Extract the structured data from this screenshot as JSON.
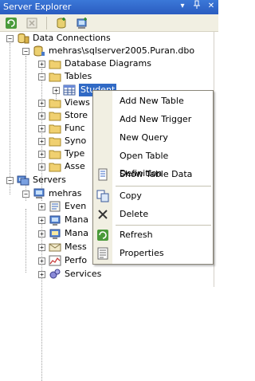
{
  "window": {
    "title": "Server Explorer",
    "controls": [
      "▾",
      "📌",
      "✕"
    ]
  },
  "toolbar": {
    "buttons": [
      "refresh-icon",
      "stop-icon",
      "connect-to-database-icon",
      "connect-to-server-icon"
    ]
  },
  "tree": {
    "data_connections": "Data Connections",
    "connection": "mehras\\sqlserver2005.Puran.dbo",
    "database_diagrams": "Database Diagrams",
    "tables": "Tables",
    "student": "Student",
    "views": "Views",
    "stored": "Store",
    "functions": "Func",
    "synonyms": "Syno",
    "types": "Type",
    "assemblies": "Asse",
    "servers": "Servers",
    "server": "mehras",
    "event_logs": "Even",
    "management_classes": "Mana",
    "management_events": "Mana",
    "message_queues": "Mess",
    "performance_counters": "Perfo",
    "services": "Services"
  },
  "context_menu": {
    "items": [
      {
        "label": "Add New Table"
      },
      {
        "label": "Add New Trigger"
      },
      {
        "label": "New Query"
      },
      {
        "label": "Open Table Definition"
      },
      {
        "label": "Show Table Data"
      },
      {
        "label": "Copy"
      },
      {
        "label": "Delete"
      },
      {
        "label": "Refresh"
      },
      {
        "label": "Properties"
      }
    ]
  }
}
